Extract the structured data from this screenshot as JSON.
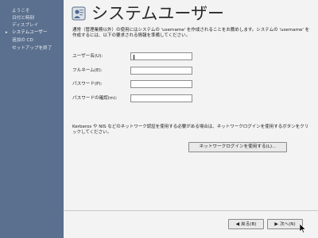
{
  "sidebar": {
    "items": [
      {
        "label": "ようこそ",
        "active": false
      },
      {
        "label": "日付と時刻",
        "active": false
      },
      {
        "label": "ディスプレイ",
        "active": false
      },
      {
        "label": "システムユーザー",
        "active": true
      },
      {
        "label": "追加の CD",
        "active": false
      },
      {
        "label": "セットアップを終了",
        "active": false
      }
    ],
    "active_arrow": "▸"
  },
  "main": {
    "title": "システムユーザー",
    "title_icon": "user-setup-icon",
    "intro": "通常（管理業務以外）の使用にはシステムの 'username' を作成されることをお薦めします。システムの 'username' を作成するには、以下の要求される情報を準備してください。",
    "form": {
      "username_label": "ユーザー名(U):",
      "fullname_label": "フルネーム(E):",
      "password_label": "パスワード(P):",
      "confirm_label": "パスワードの確認(m):",
      "username_value": "",
      "fullname_value": "",
      "password_value": "",
      "confirm_value": ""
    },
    "network_text": "Kerberos や NIS などのネットワーク認証を使用する必要がある場合は、ネットワークログインを使用するボタンをクリックしてください。",
    "network_button": "ネットワークログインを使用する(L)..."
  },
  "footer": {
    "back_label": "戻る(B)",
    "next_label": "次へ(N)",
    "back_icon": "arrow-left-icon",
    "next_icon": "arrow-right-icon"
  },
  "colors": {
    "sidebar_bg": "#5b708e",
    "panel_bg": "#f3f3f3"
  }
}
